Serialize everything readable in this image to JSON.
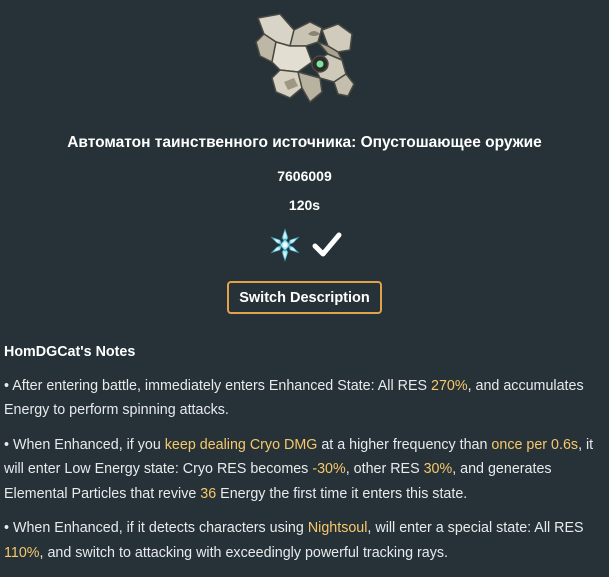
{
  "enemy": {
    "name": "Автоматон таинственного источника: Опустошающее оружие",
    "hp": "7606009",
    "time": "120s",
    "image_icon": "automaton-weapon-icon",
    "element_icon": "cryo-icon",
    "status_icon": "checkmark-icon"
  },
  "switch_button": {
    "label": "Switch Description"
  },
  "notes": {
    "heading": "HomDGCat's Notes",
    "note1": {
      "t1": "• After entering battle, immediately enters Enhanced State: All RES ",
      "h1": "270%",
      "t2": ", and accumulates Energy to perform spinning attacks."
    },
    "note2": {
      "t1": "• When Enhanced, if you ",
      "h1": "keep dealing Cryo DMG",
      "t2": " at a higher frequency than ",
      "h2": "once per 0.6s",
      "t3": ", it will enter Low Energy state: Cryo RES becomes ",
      "h3": "-30%",
      "t4": ", other RES ",
      "h4": "30%",
      "t5": ", and generates Elemental Particles that revive ",
      "h5": "36",
      "t6": " Energy the first time it enters this state."
    },
    "note3": {
      "t1": "• When Enhanced, if it detects characters using ",
      "h1": "Nightsoul",
      "t2": ", will enter a special state: All RES ",
      "h2": "110%",
      "t3": ", and switch to attacking with exceedingly powerful tracking rays."
    }
  },
  "colors": {
    "background": "#263238",
    "highlight": "#f6c86b",
    "button_border": "#e0a24a",
    "cryo": "#9fe6f5"
  }
}
